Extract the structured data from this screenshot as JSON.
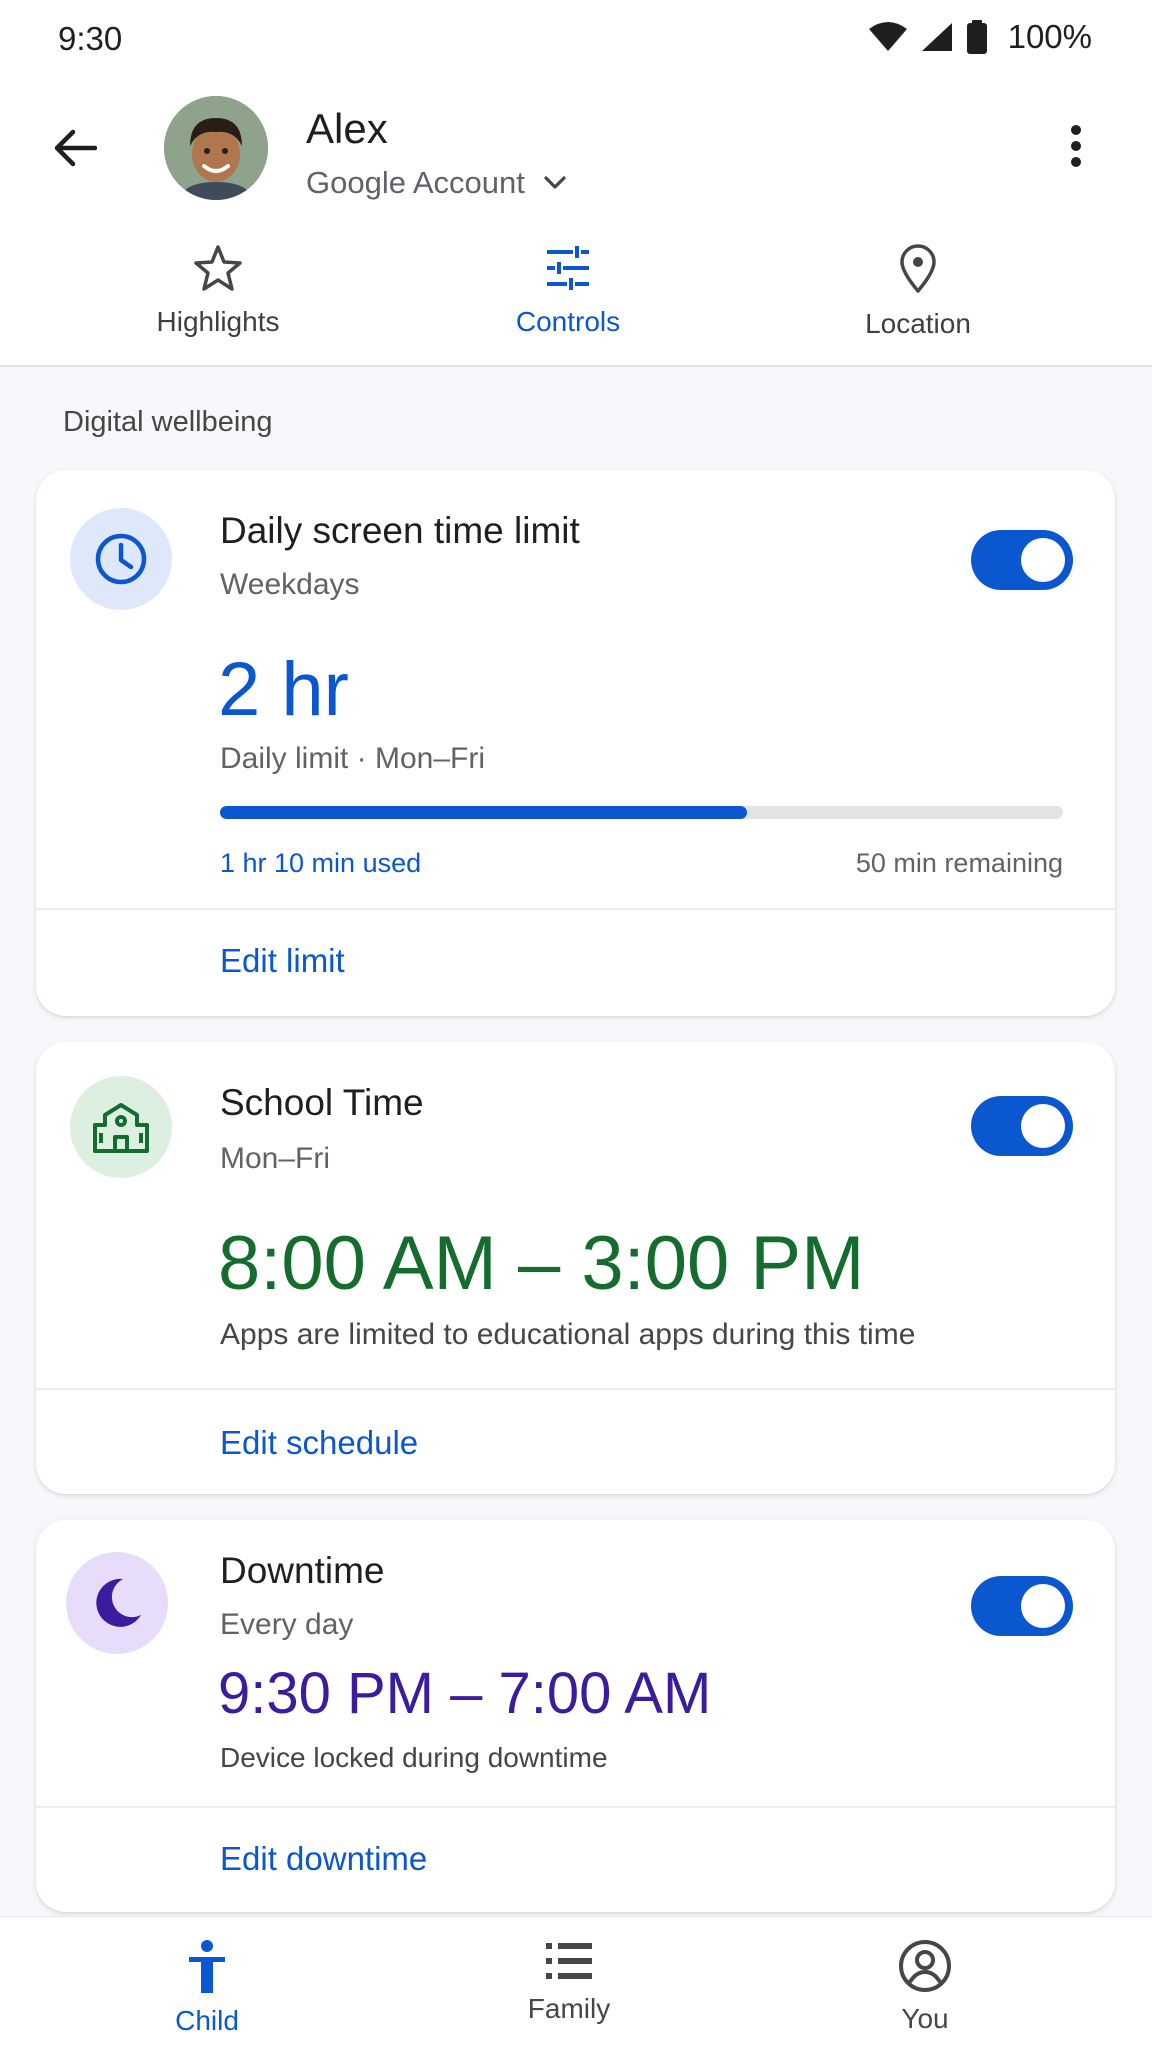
{
  "status_bar": {
    "time": "9:30",
    "battery": "100%"
  },
  "header": {
    "name": "Alex",
    "account_label": "Google Account"
  },
  "tabs": [
    {
      "label": "Highlights",
      "icon": "star-icon",
      "active": false
    },
    {
      "label": "Controls",
      "icon": "tune-icon",
      "active": true
    },
    {
      "label": "Location",
      "icon": "location-pin-icon",
      "active": false
    }
  ],
  "section_title": "Digital wellbeing",
  "cards": {
    "screen_time": {
      "title": "Daily screen time limit",
      "subtitle": "Weekdays",
      "value": "2 hr",
      "description": "Daily limit · Mon–Fri",
      "progress_fraction": 0.625,
      "used": "1 hr 10 min used",
      "remaining": "50 min remaining",
      "action": "Edit limit",
      "enabled": true,
      "accent": "#0b57d0",
      "icon": "clock-icon"
    },
    "school_time": {
      "title": "School Time",
      "subtitle": "Mon–Fri",
      "value": "8:00 AM – 3:00 PM",
      "description": "Apps are limited to educational apps during this time",
      "action": "Edit schedule",
      "enabled": true,
      "accent": "#146c2e",
      "icon": "school-icon"
    },
    "downtime": {
      "title": "Downtime",
      "subtitle": "Every day",
      "value": "9:30 PM – 7:00 AM",
      "description": "Device locked during downtime",
      "action": "Edit downtime",
      "enabled": true,
      "accent": "#3b1c9e",
      "icon": "moon-icon"
    }
  },
  "bottom_nav": [
    {
      "label": "Child",
      "icon": "child-icon",
      "active": true
    },
    {
      "label": "Family",
      "icon": "list-icon",
      "active": false
    },
    {
      "label": "You",
      "icon": "account-circle-icon",
      "active": false
    }
  ]
}
